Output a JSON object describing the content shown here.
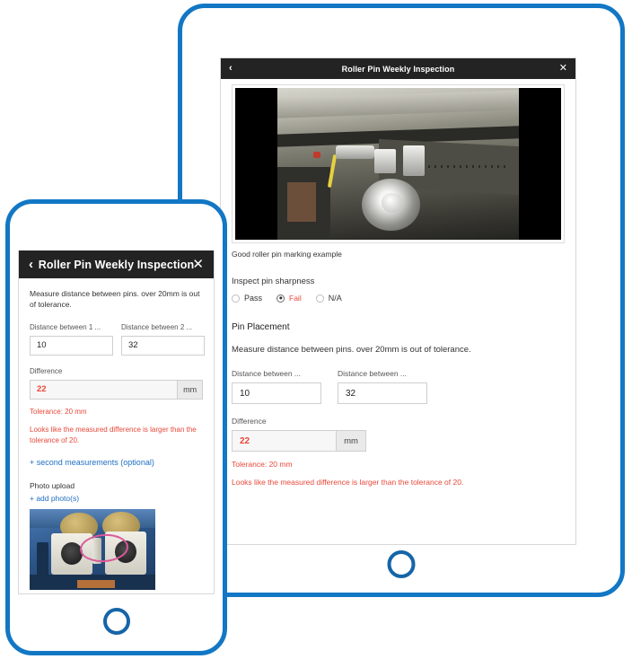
{
  "theme": {
    "device_border": "#1277c4",
    "home_button": "#1565a8",
    "titlebar_bg": "#232323",
    "error_red": "#e8483a",
    "link_blue": "#1f6fc4",
    "annotation_pink": "#d95a9a"
  },
  "tablet": {
    "titlebar": {
      "back_icon": "chevron-left",
      "title": "Roller Pin Weekly Inspection",
      "close_icon": "close-x"
    },
    "photo": {
      "alt": "machine-roller-pin-photo",
      "caption": "Good roller pin marking example"
    },
    "sharpness": {
      "label": "Inspect pin sharpness",
      "options": [
        {
          "label": "Pass",
          "selected": false
        },
        {
          "label": "Fail",
          "selected": true
        },
        {
          "label": "N/A",
          "selected": false
        }
      ]
    },
    "pin_placement": {
      "section_title": "Pin Placement",
      "helper": "Measure distance between pins. over 20mm is out of tolerance.",
      "field1_label": "Distance between ...",
      "field1_value": "10",
      "field2_label": "Distance between ...",
      "field2_value": "32",
      "difference_label": "Difference",
      "difference_value": "22",
      "unit": "mm",
      "tolerance_text": "Tolerance:  20   mm",
      "error_text": "Looks like the measured difference is larger than the tolerance of 20."
    }
  },
  "phone": {
    "titlebar": {
      "back_icon": "chevron-left",
      "title": "Roller Pin Weekly Inspection",
      "close_icon": "close-x"
    },
    "pin_placement": {
      "helper": "Measure distance between pins. over 20mm is out of tolerance.",
      "field1_label": "Distance between 1 ...",
      "field1_value": "10",
      "field2_label": "Distance between 2 ...",
      "field2_value": "32",
      "difference_label": "Difference",
      "difference_value": "22",
      "unit": "mm",
      "tolerance_text": "Tolerance:  20   mm",
      "error_text": "Looks like the measured difference is larger than the tolerance of 20.",
      "second_measurements_link": "+ second measurements (optional)"
    },
    "photo_upload": {
      "label": "Photo upload",
      "add_link": "+ add photo(s)",
      "thumbnail_alt": "roller-pin-thumbnail-with-pink-annotation"
    }
  }
}
